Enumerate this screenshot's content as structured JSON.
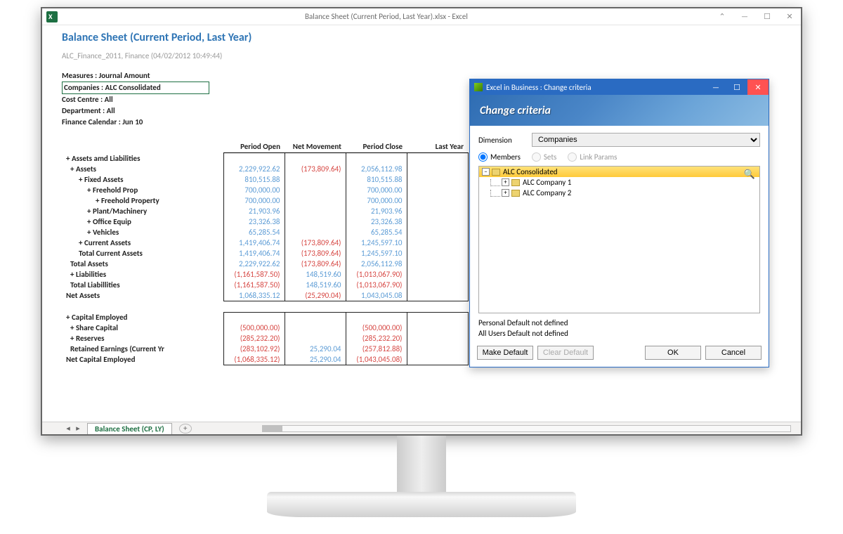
{
  "excel": {
    "title": "Balance Sheet (Current Period, Last Year).xlsx - Excel",
    "sheet_tab": "Balance Sheet (CP, LY)"
  },
  "report": {
    "title": "Balance Sheet (Current Period, Last Year)",
    "subtitle": "ALC_Finance_2011, Finance (04/02/2012 10:49:44)",
    "filters": {
      "measures": "Measures : Journal Amount",
      "companies": "Companies : ALC Consolidated",
      "cost_centre": "Cost Centre : All",
      "department": "Department : All",
      "calendar": "Finance Calendar : Jun 10"
    },
    "columns": [
      "Period Open",
      "Net Movement",
      "Period Close",
      "Last Year"
    ],
    "rows": [
      {
        "label": "+ Assets amd Liabilities",
        "indent": 0
      },
      {
        "label": "+ Assets",
        "indent": 1,
        "vals": [
          "2,229,922.62",
          "(173,809.64)",
          "2,056,112.98",
          ""
        ],
        "neg": [
          false,
          true,
          false,
          false
        ]
      },
      {
        "label": "+ Fixed Assets",
        "indent": 2,
        "vals": [
          "810,515.88",
          "",
          "810,515.88",
          ""
        ]
      },
      {
        "label": "+ Freehold Prop",
        "indent": 3,
        "vals": [
          "700,000.00",
          "",
          "700,000.00",
          ""
        ]
      },
      {
        "label": "+ Freehold Property",
        "indent": 4,
        "vals": [
          "700,000.00",
          "",
          "700,000.00",
          ""
        ]
      },
      {
        "label": "+ Plant/Machinery",
        "indent": 3,
        "vals": [
          "21,903.96",
          "",
          "21,903.96",
          ""
        ]
      },
      {
        "label": "+ Office Equip",
        "indent": 3,
        "vals": [
          "23,326.38",
          "",
          "23,326.38",
          ""
        ]
      },
      {
        "label": "+ Vehicles",
        "indent": 3,
        "vals": [
          "65,285.54",
          "",
          "65,285.54",
          ""
        ]
      },
      {
        "label": "+ Current Assets",
        "indent": 2,
        "vals": [
          "1,419,406.74",
          "(173,809.64)",
          "1,245,597.10",
          ""
        ],
        "neg": [
          false,
          true,
          false,
          false
        ]
      },
      {
        "label": "Total Current Assets",
        "indent": 2,
        "vals": [
          "1,419,406.74",
          "(173,809.64)",
          "1,245,597.10",
          ""
        ],
        "neg": [
          false,
          true,
          false,
          false
        ]
      },
      {
        "label": "Total Assets",
        "indent": 1,
        "vals": [
          "2,229,922.62",
          "(173,809.64)",
          "2,056,112.98",
          ""
        ],
        "neg": [
          false,
          true,
          false,
          false
        ]
      },
      {
        "label": "+ Liabilities",
        "indent": 1,
        "vals": [
          "(1,161,587.50)",
          "148,519.60",
          "(1,013,067.90)",
          ""
        ],
        "neg": [
          true,
          false,
          true,
          false
        ]
      },
      {
        "label": "Total Liabillities",
        "indent": 1,
        "vals": [
          "(1,161,587.50)",
          "148,519.60",
          "(1,013,067.90)",
          ""
        ],
        "neg": [
          true,
          false,
          true,
          false
        ]
      },
      {
        "label": "Net Assets",
        "indent": 0,
        "vals": [
          "1,068,335.12",
          "(25,290.04)",
          "1,043,045.08",
          ""
        ],
        "neg": [
          false,
          true,
          false,
          false
        ],
        "botline": true
      },
      {
        "label": "",
        "indent": 0,
        "spacer": true
      },
      {
        "label": "+ Capital Employed",
        "indent": 0,
        "topline": true
      },
      {
        "label": "+ Share Capital",
        "indent": 1,
        "vals": [
          "(500,000.00)",
          "",
          "(500,000.00)",
          ""
        ],
        "neg": [
          true,
          false,
          true,
          false
        ]
      },
      {
        "label": "+ Reserves",
        "indent": 1,
        "vals": [
          "(285,232.20)",
          "",
          "(285,232.20)",
          ""
        ],
        "neg": [
          true,
          false,
          true,
          false
        ]
      },
      {
        "label": "Retained Earnings (Current Yr",
        "indent": 1,
        "vals": [
          "(283,102.92)",
          "25,290.04",
          "(257,812.88)",
          ""
        ],
        "neg": [
          true,
          false,
          true,
          false
        ]
      },
      {
        "label": "Net Capital Employed",
        "indent": 0,
        "vals": [
          "(1,068,335.12)",
          "25,290.04",
          "(1,043,045.08)",
          ""
        ],
        "neg": [
          true,
          false,
          true,
          false
        ],
        "botline": true
      }
    ]
  },
  "dialog": {
    "window_title": "Excel in Business : Change criteria",
    "banner": "Change criteria",
    "dimension_label": "Dimension",
    "dimension_value": "Companies",
    "radio_members": "Members",
    "radio_sets": "Sets",
    "radio_link": "Link Params",
    "tree": {
      "root": "ALC Consolidated",
      "children": [
        "ALC Company 1",
        "ALC Company 2"
      ]
    },
    "personal_default": "Personal Default not defined",
    "all_users_default": "All Users Default not defined",
    "buttons": {
      "make_default": "Make Default",
      "clear_default": "Clear Default",
      "ok": "OK",
      "cancel": "Cancel"
    }
  }
}
